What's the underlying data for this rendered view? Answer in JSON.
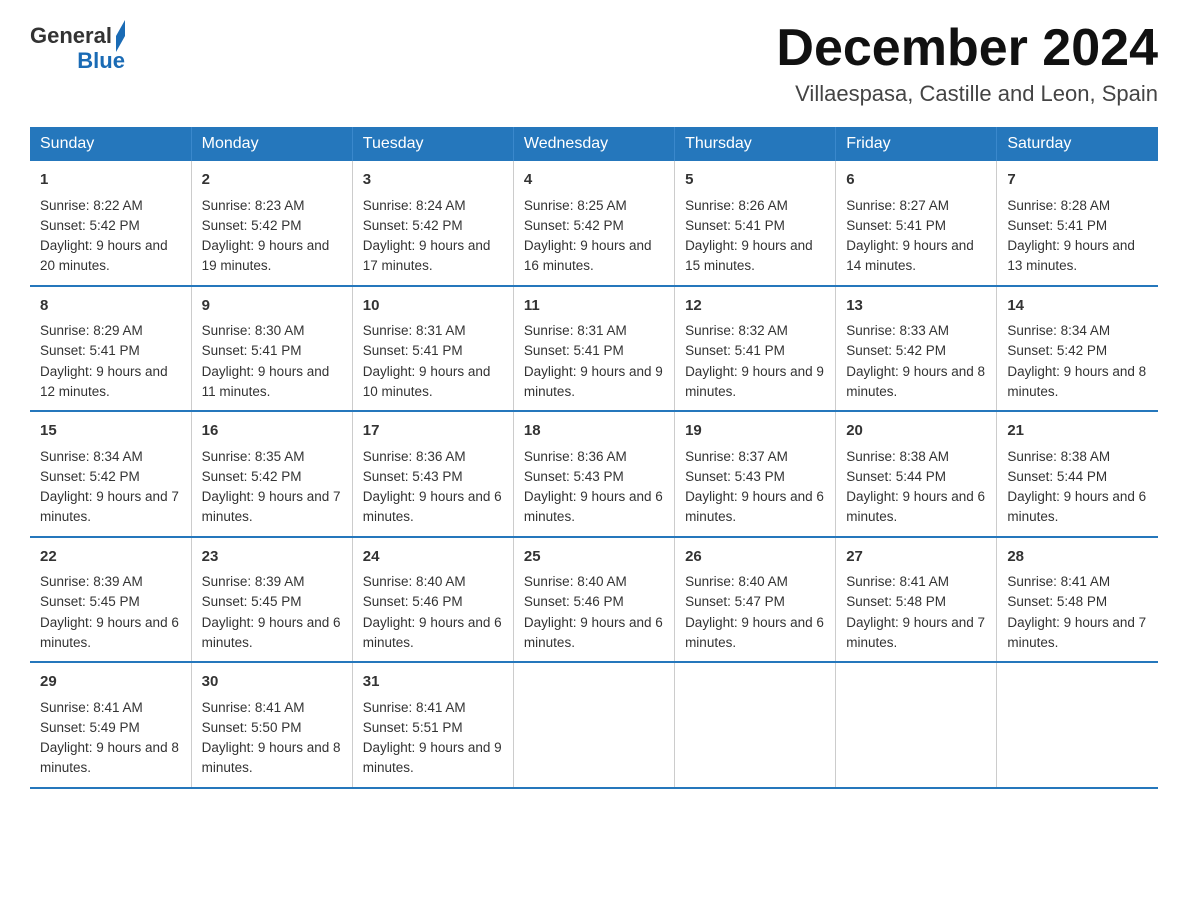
{
  "header": {
    "logo_general": "General",
    "logo_blue": "Blue",
    "month_title": "December 2024",
    "subtitle": "Villaespasa, Castille and Leon, Spain"
  },
  "weekdays": [
    "Sunday",
    "Monday",
    "Tuesday",
    "Wednesday",
    "Thursday",
    "Friday",
    "Saturday"
  ],
  "weeks": [
    [
      {
        "day": "1",
        "sunrise": "8:22 AM",
        "sunset": "5:42 PM",
        "daylight": "9 hours and 20 minutes."
      },
      {
        "day": "2",
        "sunrise": "8:23 AM",
        "sunset": "5:42 PM",
        "daylight": "9 hours and 19 minutes."
      },
      {
        "day": "3",
        "sunrise": "8:24 AM",
        "sunset": "5:42 PM",
        "daylight": "9 hours and 17 minutes."
      },
      {
        "day": "4",
        "sunrise": "8:25 AM",
        "sunset": "5:42 PM",
        "daylight": "9 hours and 16 minutes."
      },
      {
        "day": "5",
        "sunrise": "8:26 AM",
        "sunset": "5:41 PM",
        "daylight": "9 hours and 15 minutes."
      },
      {
        "day": "6",
        "sunrise": "8:27 AM",
        "sunset": "5:41 PM",
        "daylight": "9 hours and 14 minutes."
      },
      {
        "day": "7",
        "sunrise": "8:28 AM",
        "sunset": "5:41 PM",
        "daylight": "9 hours and 13 minutes."
      }
    ],
    [
      {
        "day": "8",
        "sunrise": "8:29 AM",
        "sunset": "5:41 PM",
        "daylight": "9 hours and 12 minutes."
      },
      {
        "day": "9",
        "sunrise": "8:30 AM",
        "sunset": "5:41 PM",
        "daylight": "9 hours and 11 minutes."
      },
      {
        "day": "10",
        "sunrise": "8:31 AM",
        "sunset": "5:41 PM",
        "daylight": "9 hours and 10 minutes."
      },
      {
        "day": "11",
        "sunrise": "8:31 AM",
        "sunset": "5:41 PM",
        "daylight": "9 hours and 9 minutes."
      },
      {
        "day": "12",
        "sunrise": "8:32 AM",
        "sunset": "5:41 PM",
        "daylight": "9 hours and 9 minutes."
      },
      {
        "day": "13",
        "sunrise": "8:33 AM",
        "sunset": "5:42 PM",
        "daylight": "9 hours and 8 minutes."
      },
      {
        "day": "14",
        "sunrise": "8:34 AM",
        "sunset": "5:42 PM",
        "daylight": "9 hours and 8 minutes."
      }
    ],
    [
      {
        "day": "15",
        "sunrise": "8:34 AM",
        "sunset": "5:42 PM",
        "daylight": "9 hours and 7 minutes."
      },
      {
        "day": "16",
        "sunrise": "8:35 AM",
        "sunset": "5:42 PM",
        "daylight": "9 hours and 7 minutes."
      },
      {
        "day": "17",
        "sunrise": "8:36 AM",
        "sunset": "5:43 PM",
        "daylight": "9 hours and 6 minutes."
      },
      {
        "day": "18",
        "sunrise": "8:36 AM",
        "sunset": "5:43 PM",
        "daylight": "9 hours and 6 minutes."
      },
      {
        "day": "19",
        "sunrise": "8:37 AM",
        "sunset": "5:43 PM",
        "daylight": "9 hours and 6 minutes."
      },
      {
        "day": "20",
        "sunrise": "8:38 AM",
        "sunset": "5:44 PM",
        "daylight": "9 hours and 6 minutes."
      },
      {
        "day": "21",
        "sunrise": "8:38 AM",
        "sunset": "5:44 PM",
        "daylight": "9 hours and 6 minutes."
      }
    ],
    [
      {
        "day": "22",
        "sunrise": "8:39 AM",
        "sunset": "5:45 PM",
        "daylight": "9 hours and 6 minutes."
      },
      {
        "day": "23",
        "sunrise": "8:39 AM",
        "sunset": "5:45 PM",
        "daylight": "9 hours and 6 minutes."
      },
      {
        "day": "24",
        "sunrise": "8:40 AM",
        "sunset": "5:46 PM",
        "daylight": "9 hours and 6 minutes."
      },
      {
        "day": "25",
        "sunrise": "8:40 AM",
        "sunset": "5:46 PM",
        "daylight": "9 hours and 6 minutes."
      },
      {
        "day": "26",
        "sunrise": "8:40 AM",
        "sunset": "5:47 PM",
        "daylight": "9 hours and 6 minutes."
      },
      {
        "day": "27",
        "sunrise": "8:41 AM",
        "sunset": "5:48 PM",
        "daylight": "9 hours and 7 minutes."
      },
      {
        "day": "28",
        "sunrise": "8:41 AM",
        "sunset": "5:48 PM",
        "daylight": "9 hours and 7 minutes."
      }
    ],
    [
      {
        "day": "29",
        "sunrise": "8:41 AM",
        "sunset": "5:49 PM",
        "daylight": "9 hours and 8 minutes."
      },
      {
        "day": "30",
        "sunrise": "8:41 AM",
        "sunset": "5:50 PM",
        "daylight": "9 hours and 8 minutes."
      },
      {
        "day": "31",
        "sunrise": "8:41 AM",
        "sunset": "5:51 PM",
        "daylight": "9 hours and 9 minutes."
      },
      null,
      null,
      null,
      null
    ]
  ]
}
